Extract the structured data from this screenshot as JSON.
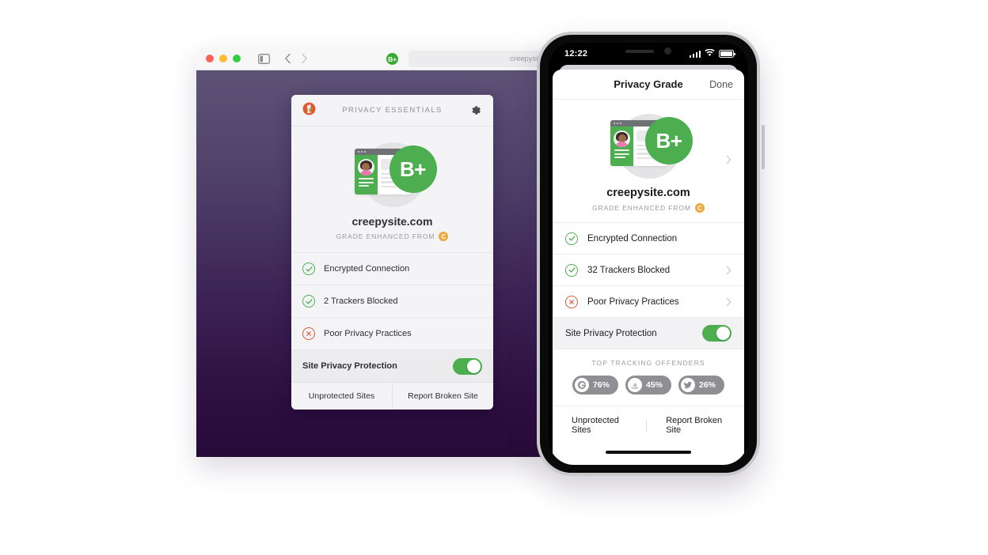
{
  "desktop": {
    "browser": {
      "traffic_lights": [
        "close",
        "minimize",
        "zoom"
      ],
      "sidebar_icon": "sidebar-icon",
      "back_icon": "chevron-left-icon",
      "forward_icon": "chevron-right-icon",
      "grade_pill": "B+",
      "address_value": "creepysite.com"
    },
    "popup": {
      "logo": "duckduckgo-logo-icon",
      "title": "PRIVACY ESSENTIALS",
      "settings_icon": "gear-icon",
      "grade_letter": "B+",
      "site_name": "creepysite.com",
      "enhanced_label": "GRADE ENHANCED FROM",
      "enhanced_from": "C",
      "rows": [
        {
          "label": "Encrypted Connection",
          "status": "ok"
        },
        {
          "label": "2 Trackers Blocked",
          "status": "ok"
        },
        {
          "label": "Poor Privacy Practices",
          "status": "bad"
        }
      ],
      "toggle": {
        "label": "Site Privacy Protection",
        "on": true
      },
      "footer": [
        {
          "label": "Unprotected Sites"
        },
        {
          "label": "Report Broken Site"
        }
      ]
    }
  },
  "phone": {
    "status_bar": {
      "time": "12:22",
      "signal_icon": "cellular-bars-icon",
      "wifi_icon": "wifi-icon",
      "battery_icon": "battery-full-icon"
    },
    "sheet": {
      "title": "Privacy Grade",
      "done_label": "Done",
      "grade_letter": "B+",
      "site_name": "creepysite.com",
      "enhanced_label": "GRADE ENHANCED FROM",
      "enhanced_from": "C",
      "rows": [
        {
          "label": "Encrypted Connection",
          "status": "ok",
          "chevron": false
        },
        {
          "label": "32 Trackers Blocked",
          "status": "ok",
          "chevron": true
        },
        {
          "label": "Poor Privacy Practices",
          "status": "bad",
          "chevron": true
        }
      ],
      "toggle": {
        "label": "Site Privacy Protection",
        "on": true
      },
      "offenders": {
        "title": "TOP TRACKING OFFENDERS",
        "items": [
          {
            "icon": "google-icon",
            "glyph": "G",
            "percent": "76%"
          },
          {
            "icon": "amazon-icon",
            "glyph": "a",
            "percent": "45%"
          },
          {
            "icon": "twitter-icon",
            "glyph": "bird",
            "percent": "26%"
          }
        ]
      },
      "footer": [
        {
          "label": "Unprotected Sites"
        },
        {
          "label": "Report Broken Site"
        }
      ]
    }
  },
  "colors": {
    "grade_green": "#4cae4f",
    "bad_red": "#de5833",
    "enhanced_amber": "#f0a73c",
    "bg_gradient_top": "#5d5276",
    "bg_gradient_bottom": "#270a38",
    "chip_gray": "#8e8e93"
  }
}
